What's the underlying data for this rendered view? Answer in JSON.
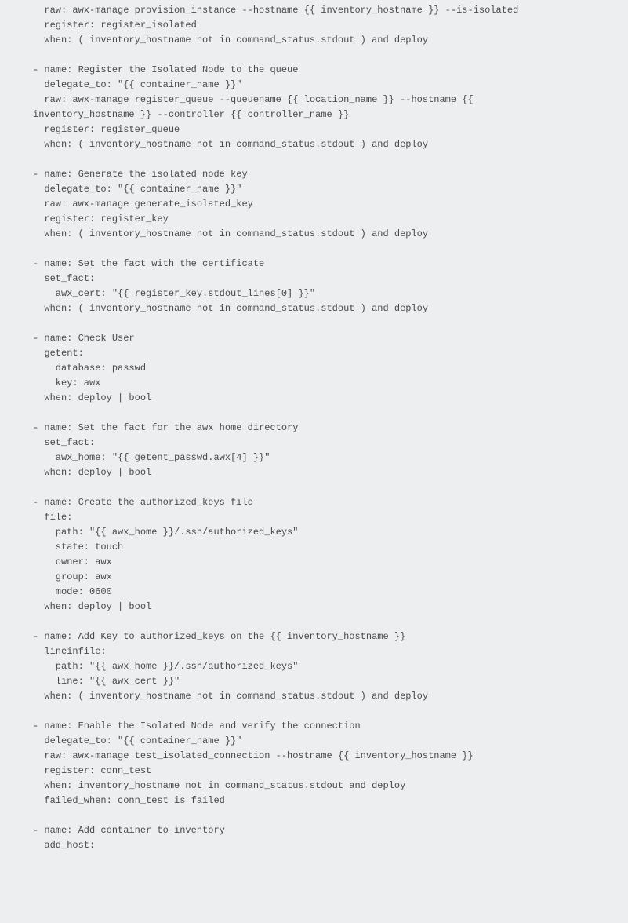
{
  "code": "  raw: awx-manage provision_instance --hostname {{ inventory_hostname }} --is-isolated\n  register: register_isolated\n  when: ( inventory_hostname not in command_status.stdout ) and deploy\n\n- name: Register the Isolated Node to the queue\n  delegate_to: \"{{ container_name }}\"\n  raw: awx-manage register_queue --queuename {{ location_name }} --hostname {{\ninventory_hostname }} --controller {{ controller_name }}\n  register: register_queue\n  when: ( inventory_hostname not in command_status.stdout ) and deploy\n\n- name: Generate the isolated node key\n  delegate_to: \"{{ container_name }}\"\n  raw: awx-manage generate_isolated_key\n  register: register_key\n  when: ( inventory_hostname not in command_status.stdout ) and deploy\n\n- name: Set the fact with the certificate\n  set_fact:\n    awx_cert: \"{{ register_key.stdout_lines[0] }}\"\n  when: ( inventory_hostname not in command_status.stdout ) and deploy\n\n- name: Check User\n  getent:\n    database: passwd\n    key: awx\n  when: deploy | bool\n\n- name: Set the fact for the awx home directory\n  set_fact:\n    awx_home: \"{{ getent_passwd.awx[4] }}\"\n  when: deploy | bool\n\n- name: Create the authorized_keys file\n  file:\n    path: \"{{ awx_home }}/.ssh/authorized_keys\"\n    state: touch\n    owner: awx\n    group: awx\n    mode: 0600\n  when: deploy | bool\n\n- name: Add Key to authorized_keys on the {{ inventory_hostname }}\n  lineinfile:\n    path: \"{{ awx_home }}/.ssh/authorized_keys\"\n    line: \"{{ awx_cert }}\"\n  when: ( inventory_hostname not in command_status.stdout ) and deploy\n\n- name: Enable the Isolated Node and verify the connection\n  delegate_to: \"{{ container_name }}\"\n  raw: awx-manage test_isolated_connection --hostname {{ inventory_hostname }}\n  register: conn_test\n  when: inventory_hostname not in command_status.stdout and deploy\n  failed_when: conn_test is failed\n\n- name: Add container to inventory\n  add_host:"
}
